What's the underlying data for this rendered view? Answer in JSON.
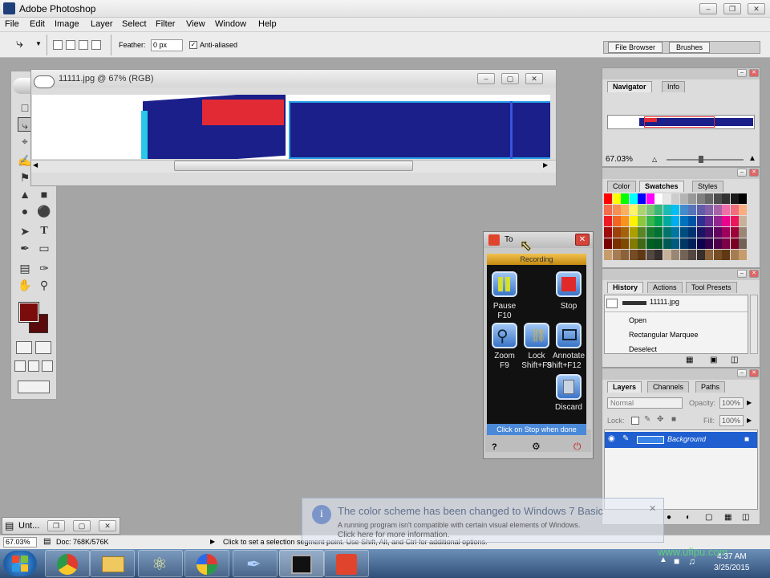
{
  "app": {
    "title": "Adobe Photoshop"
  },
  "menu": [
    "File",
    "Edit",
    "Image",
    "Layer",
    "Select",
    "Filter",
    "View",
    "Window",
    "Help"
  ],
  "options": {
    "feather_label": "Feather:",
    "feather_value": "0 px",
    "anti_aliased_label": "Anti-aliased",
    "anti_aliased_checked": true,
    "file_browser_label": "File Browser",
    "brushes_label": "Brushes"
  },
  "document": {
    "title": "11111.jpg @ 67% (RGB)"
  },
  "colors": {
    "foreground": "#7a0c0c",
    "background": "#5a0a0a",
    "canvas_blue": "#1a1f8a",
    "canvas_red": "#e22a35",
    "layer_highlight": "#1f5fd0"
  },
  "navigator": {
    "tabs": [
      "Navigator",
      "Info"
    ],
    "zoom": "67.03%"
  },
  "swatches": {
    "tabs": [
      "Color",
      "Swatches",
      "Styles"
    ],
    "rows": [
      [
        "#ff0000",
        "#ffff00",
        "#00ff00",
        "#00ffff",
        "#0000ff",
        "#ff00ff",
        "#ffffff",
        "#e6e6e6",
        "#cccccc",
        "#b3b3b3",
        "#999999",
        "#808080",
        "#666666",
        "#4d4d4d",
        "#333333",
        "#1a1a1a",
        "#000000"
      ],
      [
        "#f26c4f",
        "#f68e55",
        "#fbaf5d",
        "#fff467",
        "#acd372",
        "#7cc576",
        "#3bb878",
        "#1abbb4",
        "#00bff3",
        "#438ccb",
        "#5574b9",
        "#605ca8",
        "#855fa8",
        "#a763a8",
        "#f06ea9",
        "#f26d7d",
        "#f9ad81"
      ],
      [
        "#ed1c24",
        "#f26522",
        "#f7941d",
        "#fff200",
        "#8dc63f",
        "#39b54a",
        "#00a651",
        "#00a99d",
        "#00aeef",
        "#0072bc",
        "#0054a6",
        "#2e3192",
        "#662d91",
        "#92278f",
        "#ec008c",
        "#ed145b",
        "#c7b299"
      ],
      [
        "#9e0b0f",
        "#a0410d",
        "#a36209",
        "#aba000",
        "#598527",
        "#1a7b30",
        "#007236",
        "#00746b",
        "#0076a3",
        "#004b80",
        "#003471",
        "#1b1464",
        "#440e62",
        "#630460",
        "#9e005d",
        "#9e0039",
        "#998675"
      ],
      [
        "#790000",
        "#7b2e00",
        "#7d4900",
        "#827b00",
        "#406618",
        "#005e20",
        "#005826",
        "#005952",
        "#005b7f",
        "#003663",
        "#002157",
        "#0d004c",
        "#32004b",
        "#4b0049",
        "#7b0046",
        "#7a0026",
        "#736357"
      ],
      [
        "#c69c6d",
        "#a67c52",
        "#8c6239",
        "#754c24",
        "#603813",
        "#534741",
        "#362f2d",
        "#c7b299",
        "#998675",
        "#736357",
        "#534741",
        "#362f2d",
        "#8c6239",
        "#754c24",
        "#603813",
        "#a67c52",
        "#c69c6d"
      ]
    ]
  },
  "history": {
    "tabs": [
      "History",
      "Actions",
      "Tool Presets"
    ],
    "snapshot": "11111.jpg",
    "items": [
      "Open",
      "Rectangular Marquee",
      "Deselect"
    ]
  },
  "layers": {
    "tabs": [
      "Layers",
      "Channels",
      "Paths"
    ],
    "blend_mode": "Normal",
    "opacity_label": "Opacity:",
    "opacity_value": "100%",
    "lock_label": "Lock:",
    "fill_label": "Fill:",
    "fill_value": "100%",
    "items": [
      "Background"
    ]
  },
  "recorder": {
    "title": "To",
    "status": "Recording",
    "buttons": [
      {
        "label": "Pause",
        "key": "F10"
      },
      {
        "label": "Stop",
        "key": ""
      },
      {
        "label": "Zoom",
        "key": "F9"
      },
      {
        "label": "Lock",
        "key": "Shift+F9"
      },
      {
        "label": "Annotate",
        "key": "Shift+F12"
      },
      {
        "label": "Discard",
        "key": ""
      }
    ],
    "footer": "Click on Stop when done"
  },
  "minimized_doc": {
    "title": "Unt..."
  },
  "status": {
    "zoom": "67.03%",
    "doc": "Doc: 768K/576K",
    "hint": "Click to set a selection segment point. Use Shift, Alt, and Ctrl for additional options."
  },
  "notification": {
    "title": "The color scheme has been changed to Windows 7 Basic",
    "line1": "A running program isn't compatible with certain visual elements of Windows.",
    "line2": "Click here for more information."
  },
  "taskbar": {
    "time": "4:37 AM",
    "date": "3/25/2015",
    "watermark": "www.ufipu.com"
  }
}
